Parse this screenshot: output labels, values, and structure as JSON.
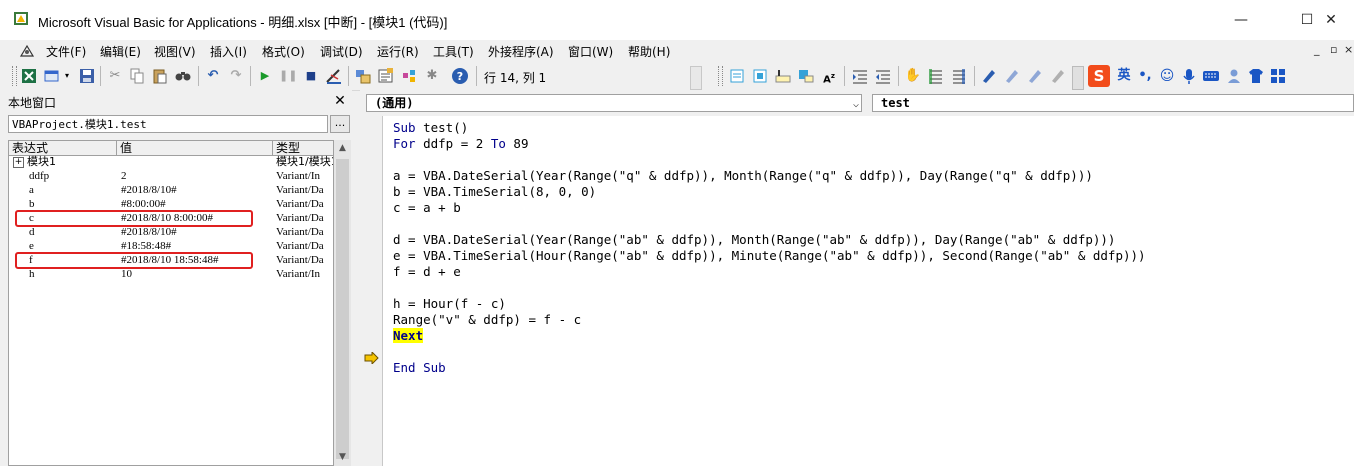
{
  "window": {
    "title": "Microsoft Visual Basic for Applications - 明细.xlsx [中断] - [模块1 (代码)]",
    "min_glyph": "—",
    "max_glyph": "☐",
    "close_glyph": "✕"
  },
  "menubar": {
    "items": [
      "文件(F)",
      "编辑(E)",
      "视图(V)",
      "插入(I)",
      "格式(O)",
      "调试(D)",
      "运行(R)",
      "工具(T)",
      "外接程序(A)",
      "窗口(W)",
      "帮助(H)"
    ],
    "mdi_min": "_",
    "mdi_restore": "▫",
    "mdi_close": "×"
  },
  "toolbar": {
    "position_text": "行 14, 列 1",
    "icons": [
      "excel-icon",
      "insert-userform-icon",
      "save-icon",
      "cut-icon",
      "copy-icon",
      "paste-icon",
      "find-icon",
      "undo-icon",
      "redo-icon",
      "run-icon",
      "break-icon",
      "reset-icon",
      "design-mode-icon",
      "project-explorer-icon",
      "properties-icon",
      "object-browser-icon",
      "toolbox-icon",
      "help-icon"
    ],
    "edit_icons": [
      "list-properties-icon",
      "list-constants-icon",
      "quick-info-icon",
      "parameter-info-icon",
      "complete-word-icon",
      "indent-icon",
      "outdent-icon",
      "toggle-breakpoint-icon",
      "comment-block-icon",
      "uncomment-block-icon",
      "toggle-bookmark-icon",
      "next-bookmark-icon",
      "prev-bookmark-icon",
      "clear-bookmarks-icon"
    ],
    "ime": {
      "logo": "S",
      "lang": "英"
    }
  },
  "locals": {
    "title": "本地窗口",
    "close": "✕",
    "context": "VBAProject.模块1.test",
    "context_btn": "...",
    "headers": {
      "expr": "表达式",
      "value": "值",
      "type": "类型"
    },
    "rows": [
      {
        "expr": "模块1",
        "value": "",
        "type": "模块1/模块1",
        "expandable": true
      },
      {
        "expr": "ddfp",
        "value": "2",
        "type": "Variant/In"
      },
      {
        "expr": "a",
        "value": "#2018/8/10#",
        "type": "Variant/Da"
      },
      {
        "expr": "b",
        "value": "#8:00:00#",
        "type": "Variant/Da"
      },
      {
        "expr": "c",
        "value": "#2018/8/10 8:00:00#",
        "type": "Variant/Da",
        "highlighted": true
      },
      {
        "expr": "d",
        "value": "#2018/8/10#",
        "type": "Variant/Da"
      },
      {
        "expr": "e",
        "value": "#18:58:48#",
        "type": "Variant/Da"
      },
      {
        "expr": "f",
        "value": "#2018/8/10 18:58:48#",
        "type": "Variant/Da",
        "highlighted": true
      },
      {
        "expr": "h",
        "value": "10",
        "type": "Variant/In"
      }
    ]
  },
  "code": {
    "object_combo": "(通用)",
    "proc_combo": "test",
    "lines": [
      "Sub test()",
      "For ddfp = 2 To 89",
      "",
      "a = VBA.DateSerial(Year(Range(\"q\" & ddfp)), Month(Range(\"q\" & ddfp)), Day(Range(\"q\" & ddfp)))",
      "b = VBA.TimeSerial(8, 0, 0)",
      "c = a + b",
      "",
      "d = VBA.DateSerial(Year(Range(\"ab\" & ddfp)), Month(Range(\"ab\" & ddfp)), Day(Range(\"ab\" & ddfp)))",
      "e = VBA.TimeSerial(Hour(Range(\"ab\" & ddfp)), Minute(Range(\"ab\" & ddfp)), Second(Range(\"ab\" & ddfp)))",
      "f = d + e",
      "",
      "h = Hour(f - c)",
      "Range(\"v\" & ddfp) = f - c",
      "Next",
      "",
      "End Sub"
    ],
    "current_line_index": 13,
    "colors": {
      "keyword": "#00008b",
      "highlight": "#ffff00",
      "exec_arrow": "#f5c400"
    }
  }
}
